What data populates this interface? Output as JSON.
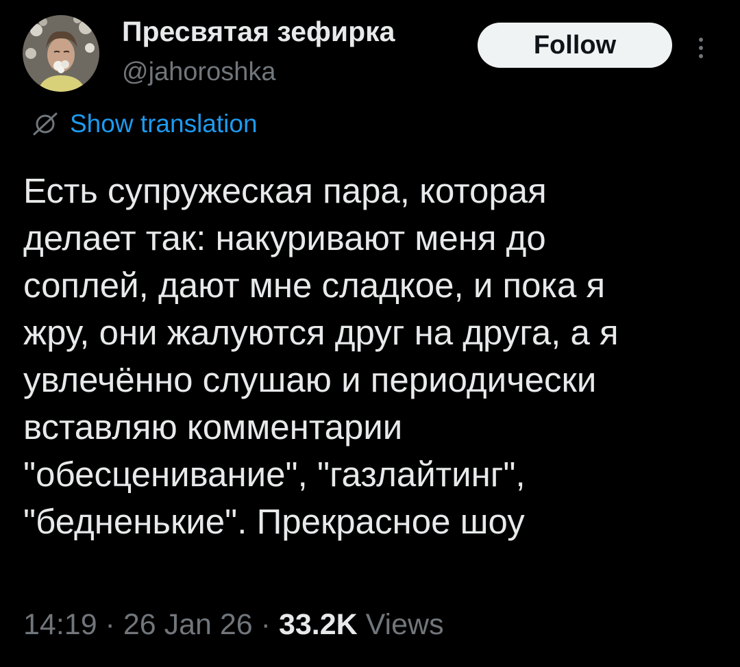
{
  "author": {
    "display_name": "Пресвятая зефирка",
    "handle": "@jahoroshka",
    "avatar_icon": "avatar-photo-icon"
  },
  "follow": {
    "label": "Follow"
  },
  "more": {
    "icon": "more-vertical-icon"
  },
  "translation": {
    "icon": "translate-icon",
    "label": "Show translation"
  },
  "tweet": {
    "lines": [
      "Есть супружеская пара, которая",
      "делает так: накуривают меня до",
      "соплей, дают мне сладкое, и пока я",
      "жру, они жалуются друг на друга, а я",
      "увлечённо слушаю и периодически",
      "вставляю комментарии",
      "\"обесценивание\", \"газлайтинг\",",
      "\"бедненькие\". Прекрасное шоу"
    ]
  },
  "meta": {
    "time": "14:19",
    "separator": " · ",
    "date": "26 Jan 26",
    "views_count": "33.2K",
    "views_label": "Views"
  },
  "colors": {
    "background": "#000000",
    "text_primary": "#e7e9ea",
    "text_secondary": "#71767b",
    "link_blue": "#1d9bf0",
    "button_bg": "#eff3f4",
    "button_text": "#0f1419"
  }
}
